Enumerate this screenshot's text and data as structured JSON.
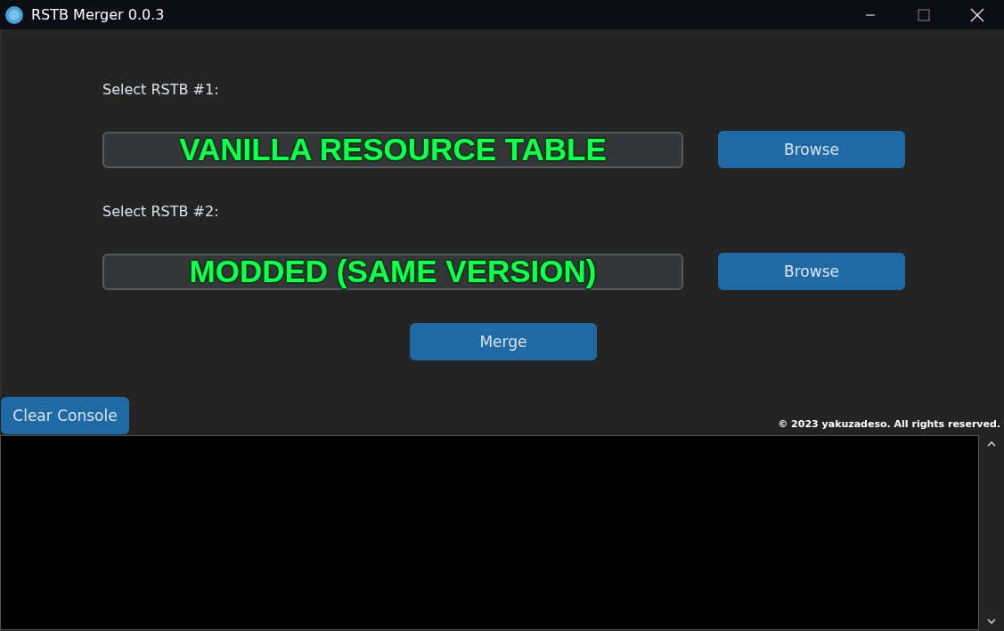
{
  "window": {
    "title": "RSTB Merger 0.0.3"
  },
  "inputs": [
    {
      "label": "Select RSTB #1:",
      "value": "VANILLA RESOURCE TABLE",
      "button": "Browse"
    },
    {
      "label": "Select RSTB #2:",
      "value": "MODDED (SAME VERSION)",
      "button": "Browse"
    }
  ],
  "merge_button": "Merge",
  "clear_button": "Clear Console",
  "copyright": "© 2023 yakuzadeso. All rights reserved."
}
